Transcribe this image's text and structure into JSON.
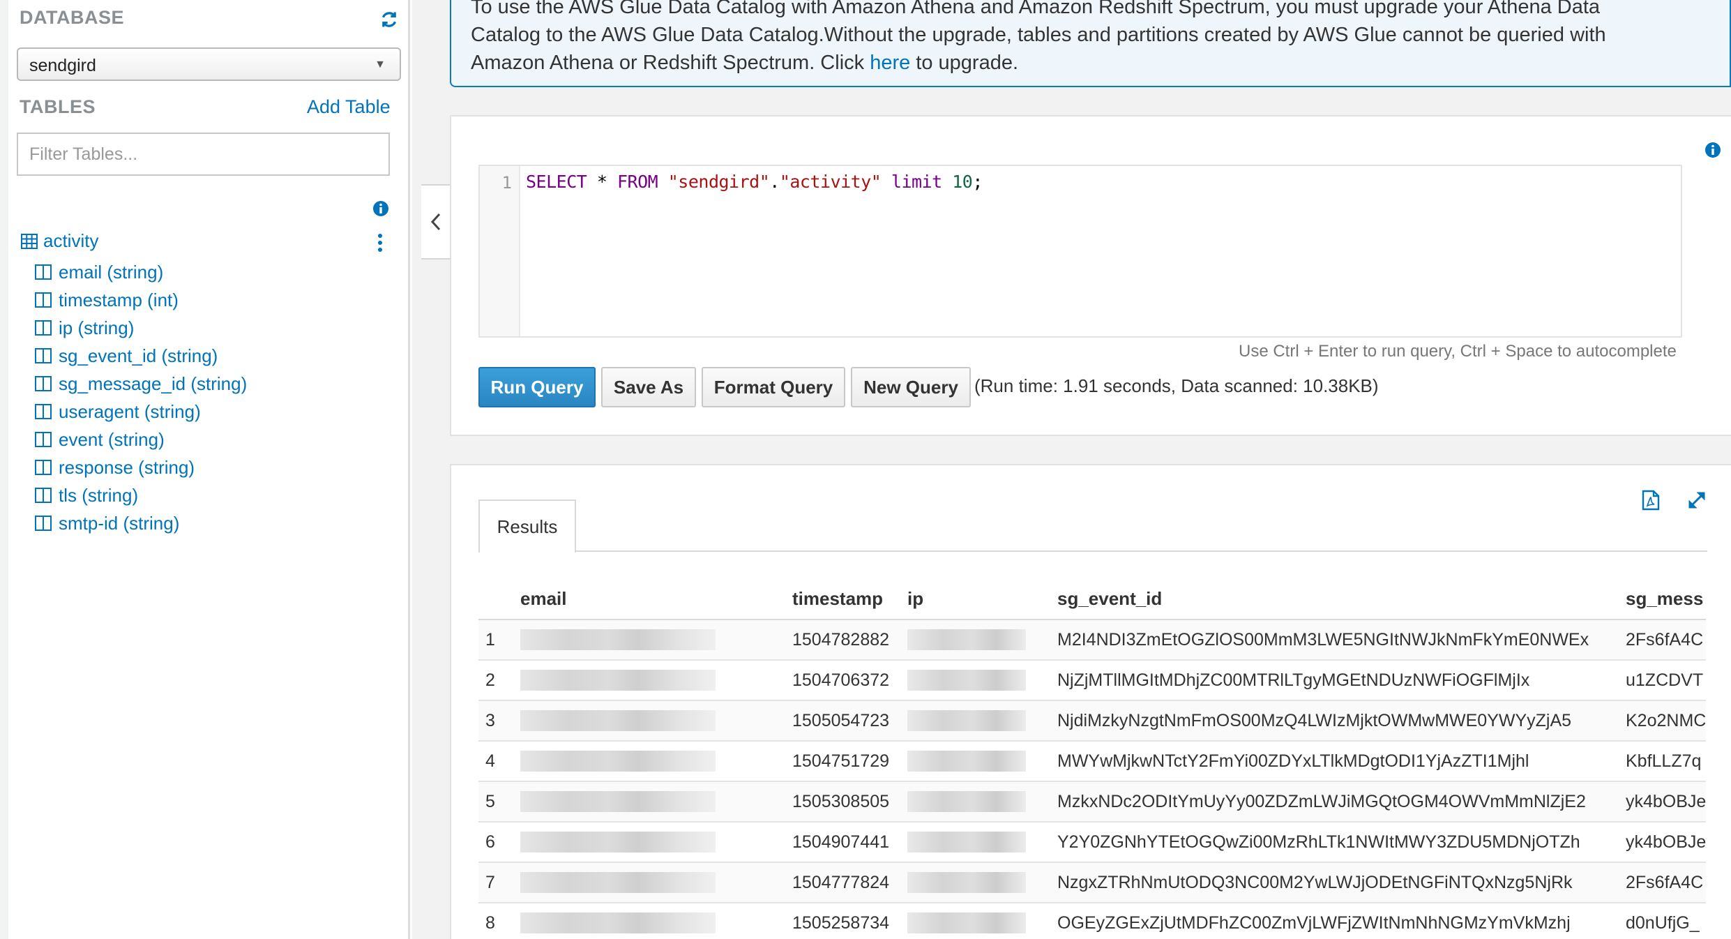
{
  "sidebar": {
    "database_heading": "DATABASE",
    "database_selected": "sendgird",
    "tables_heading": "TABLES",
    "add_table_label": "Add Table",
    "filter_placeholder": "Filter Tables...",
    "table_name": "activity",
    "columns": [
      "email (string)",
      "timestamp (int)",
      "ip (string)",
      "sg_event_id (string)",
      "sg_message_id (string)",
      "useragent (string)",
      "event (string)",
      "response (string)",
      "tls (string)",
      "smtp-id (string)"
    ]
  },
  "banner": {
    "line1": "To use the AWS Glue Data Catalog with Amazon Athena and Amazon Redshift Spectrum, you must upgrade your Athena Data",
    "line2": "Catalog to the AWS Glue Data Catalog.Without the upgrade, tables and partitions created by AWS Glue cannot be queried with",
    "line3_before": "Amazon Athena or Redshift Spectrum. Click ",
    "link": "here",
    "line3_after": " to upgrade."
  },
  "editor": {
    "line_number": "1",
    "tokens": {
      "select": "SELECT",
      "star": " * ",
      "from": "FROM",
      "space": " ",
      "db": "\"sendgird\"",
      "dot": ".",
      "table": "\"activity\"",
      "space2": " ",
      "limit": "limit",
      "space3": " ",
      "num": "10",
      "semi": ";"
    },
    "hint": "Use Ctrl + Enter to run query, Ctrl + Space to autocomplete"
  },
  "toolbar": {
    "run_label": "Run Query",
    "save_as_label": "Save As",
    "format_label": "Format Query",
    "new_label": "New Query",
    "runtime_text": "(Run time: 1.91 seconds, Data scanned: 10.38KB)"
  },
  "results": {
    "tab_label": "Results",
    "columns": [
      "email",
      "timestamp",
      "ip",
      "sg_event_id",
      "sg_mess"
    ],
    "rows": [
      {
        "n": "1",
        "timestamp": "1504782882",
        "sg_event_id": "M2I4NDI3ZmEtOGZlOS00MmM3LWE5NGItNWJkNmFkYmE0NWEx",
        "sg_message": "2Fs6fA4C"
      },
      {
        "n": "2",
        "timestamp": "1504706372",
        "sg_event_id": "NjZjMTllMGItMDhjZC00MTRlLTgyMGEtNDUzNWFiOGFlMjIx",
        "sg_message": "u1ZCDVT"
      },
      {
        "n": "3",
        "timestamp": "1505054723",
        "sg_event_id": "NjdiMzkyNzgtNmFmOS00MzQ4LWIzMjktOWMwMWE0YWYyZjA5",
        "sg_message": "K2o2NMC"
      },
      {
        "n": "4",
        "timestamp": "1504751729",
        "sg_event_id": "MWYwMjkwNTctY2FmYi00ZDYxLTlkMDgtODI1YjAzZTI1Mjhl",
        "sg_message": "KbfLLZ7q"
      },
      {
        "n": "5",
        "timestamp": "1505308505",
        "sg_event_id": "MzkxNDc2ODItYmUyYy00ZDZmLWJiMGQtOGM4OWVmMmNlZjE2",
        "sg_message": "yk4bOBJe"
      },
      {
        "n": "6",
        "timestamp": "1504907441",
        "sg_event_id": "Y2Y0ZGNhYTEtOGQwZi00MzRhLTk1NWItMWY3ZDU5MDNjOTZh",
        "sg_message": "yk4bOBJe"
      },
      {
        "n": "7",
        "timestamp": "1504777824",
        "sg_event_id": "NzgxZTRhNmUtODQ3NC00M2YwLWJjODEtNGFiNTQxNzg5NjRk",
        "sg_message": "2Fs6fA4C"
      },
      {
        "n": "8",
        "timestamp": "1505258734",
        "sg_event_id": "OGEyZGExZjUtMDFhZC00ZmVjLWFjZWItNmNhNGMzYmVkMzhj",
        "sg_message": "d0nUfjG_"
      }
    ]
  },
  "colors": {
    "accent": "#0073bb",
    "primary_button": "#2a86c2",
    "banner_border": "#0a79c1"
  },
  "icons": [
    "refresh-icon",
    "info-icon",
    "table-icon",
    "column-icon",
    "more-vertical-icon",
    "chevron-left-icon",
    "pdf-icon",
    "expand-icon",
    "dropdown-caret-icon"
  ]
}
